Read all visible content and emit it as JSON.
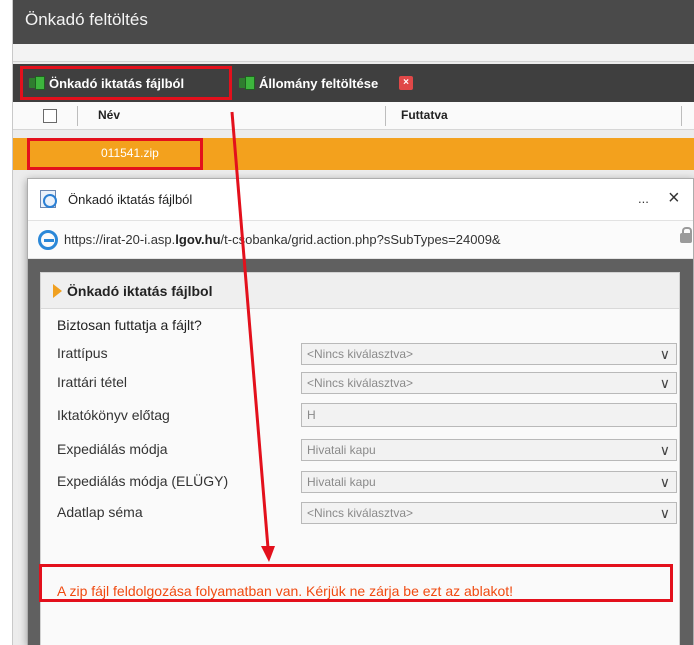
{
  "app": {
    "title": "Önkadó feltöltés"
  },
  "toolbar": {
    "btn_import_label": "Önkadó iktatás fájlból",
    "btn_upload_label": "Állomány feltöltése",
    "btn_close_glyph": "×"
  },
  "grid": {
    "col_name": "Név",
    "col_run": "Futtatva",
    "rows": [
      {
        "name": "011541.zip"
      }
    ]
  },
  "dialog": {
    "title": "Önkadó iktatás fájlból",
    "more_glyph": "...",
    "close_glyph": "×",
    "url_prefix": "https://irat-20-i.asp.",
    "url_domain": "lgov.hu",
    "url_rest": "/t-csobanka/grid.action.php?sSubTypes=24009&",
    "panel_title": "Önkadó iktatás fájlbol",
    "question": "Biztosan futtatja a fájlt?",
    "fields": [
      {
        "label": "Irattípus",
        "value": "<Nincs kiválasztva>"
      },
      {
        "label": "Irattári tétel",
        "value": "<Nincs kiválasztva>"
      },
      {
        "label": "Iktatókönyv előtag",
        "value": "H"
      },
      {
        "label": "Expediálás módja",
        "value": "Hivatali kapu"
      },
      {
        "label": "Expediálás módja (ELÜGY)",
        "value": "Hivatali kapu"
      },
      {
        "label": "Adatlap séma",
        "value": "<Nincs kiválasztva>"
      }
    ],
    "status_message": "A zip fájl feldolgozása folyamatban van. Kérjük ne zárja be ezt az ablakot!"
  },
  "colors": {
    "annotation": "#e3101c",
    "selected_row": "#f3a11d",
    "status_text": "#f04a10"
  }
}
